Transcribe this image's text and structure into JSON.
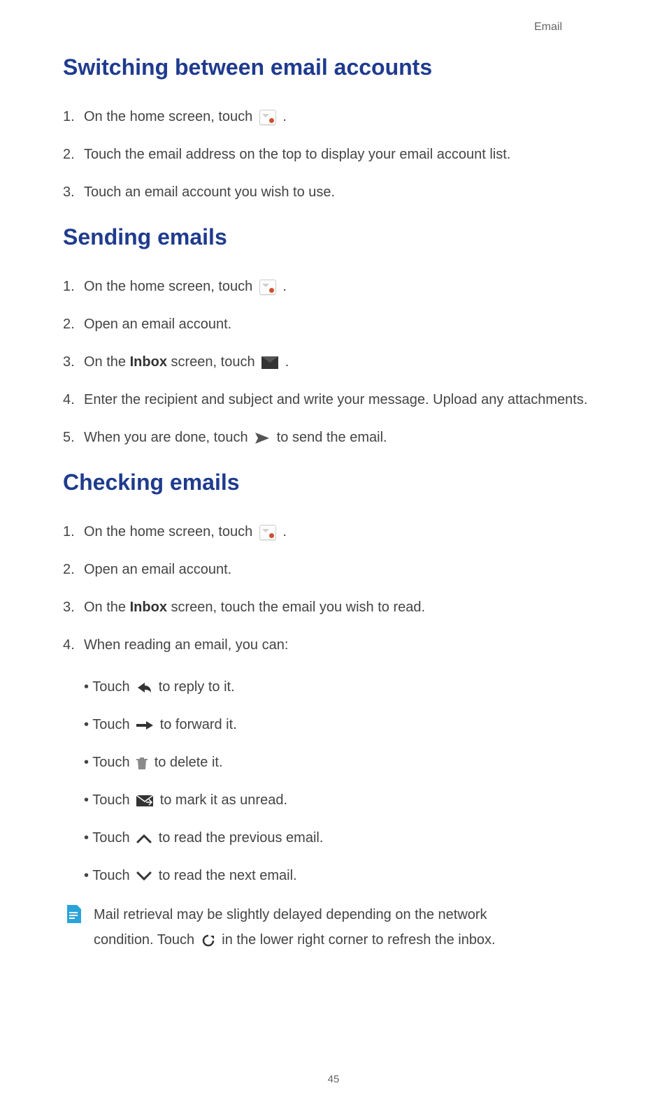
{
  "header_label": "Email",
  "page_number": "45",
  "sections": {
    "switching": {
      "heading": "Switching between email accounts",
      "steps": {
        "s1_pre": "On the home screen, touch ",
        "s1_post": " .",
        "s2": "Touch the email address on the top to display your email account list.",
        "s3": "Touch an email account you wish to use."
      }
    },
    "sending": {
      "heading": "Sending emails",
      "steps": {
        "s1_pre": "On the home screen, touch ",
        "s1_post": " .",
        "s2": "Open an email account.",
        "s3_pre": "On the ",
        "s3_bold": "Inbox",
        "s3_mid": " screen, touch ",
        "s3_post": " .",
        "s4": "Enter the recipient and subject and write your message. Upload any attachments.",
        "s5_pre": "When you are done, touch ",
        "s5_post": " to send the email."
      }
    },
    "checking": {
      "heading": "Checking emails",
      "steps": {
        "s1_pre": "On the home screen, touch ",
        "s1_post": " .",
        "s2": "Open an email account.",
        "s3_pre": "On the ",
        "s3_bold": "Inbox",
        "s3_post": " screen, touch the email you wish to read.",
        "s4": "When reading an email, you can:",
        "bullets": {
          "b1_pre": "Touch ",
          "b1_post": " to reply to it.",
          "b2_pre": "Touch ",
          "b2_post": " to forward it.",
          "b3_pre": "Touch ",
          "b3_post": " to delete it.",
          "b4_pre": "Touch ",
          "b4_post": " to mark it as unread.",
          "b5_pre": "Touch ",
          "b5_post": " to read the previous email.",
          "b6_pre": "Touch ",
          "b6_post": " to read the next email."
        }
      },
      "note": {
        "line1": "Mail retrieval may be slightly delayed depending on the network ",
        "line2_pre": "condition. Touch ",
        "line2_post": " in the lower right corner to refresh the inbox."
      }
    }
  },
  "numerals": {
    "n1": "1.",
    "n2": "2.",
    "n3": "3.",
    "n4": "4.",
    "n5": "5."
  }
}
